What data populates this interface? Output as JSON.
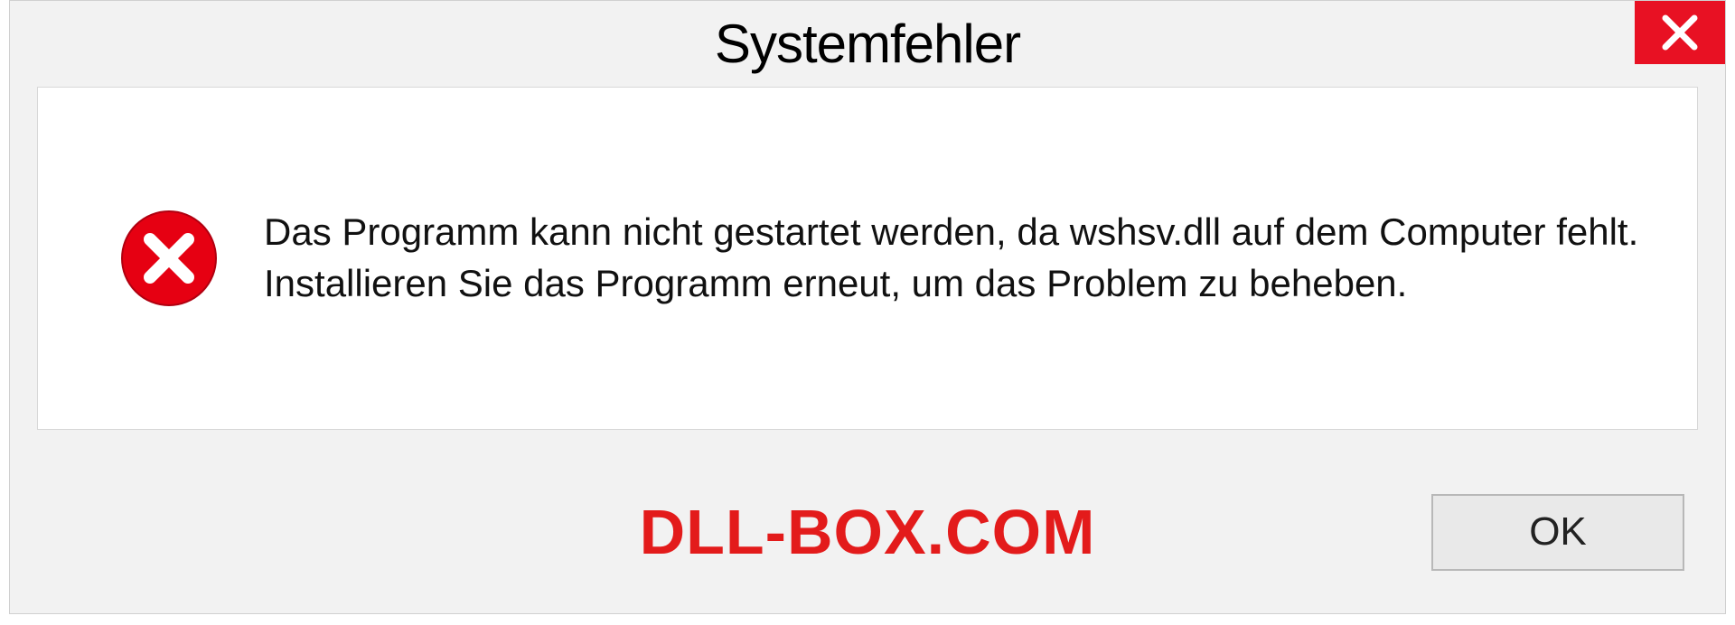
{
  "dialog": {
    "title": "Systemfehler",
    "message": "Das Programm kann nicht gestartet werden, da wshsv.dll auf dem Computer fehlt. Installieren Sie das Programm erneut, um das Problem zu beheben.",
    "ok_label": "OK"
  },
  "watermark": "DLL-BOX.COM"
}
